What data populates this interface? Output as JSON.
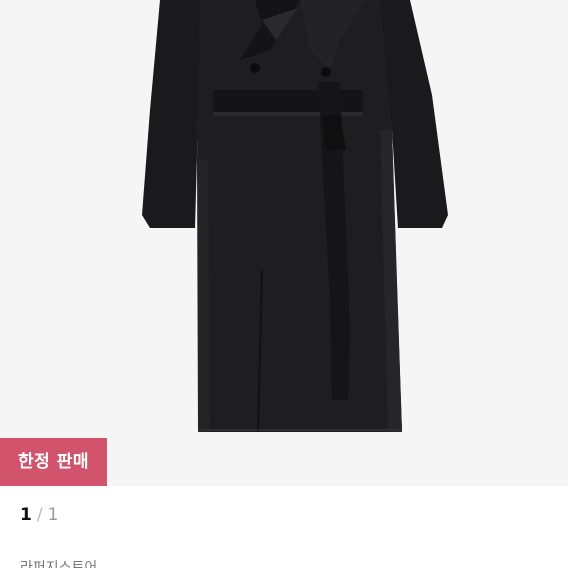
{
  "product": {
    "badge_label": "한정 판매",
    "image_description_icon": "coat-photo"
  },
  "pager": {
    "current": "1",
    "separator": "/",
    "total": "1"
  },
  "shop": {
    "name": "라퍼지스토어"
  },
  "colors": {
    "badge_bg": "#d2546c",
    "image_bg": "#f5f5f5",
    "coat": "#1c1c1e"
  }
}
